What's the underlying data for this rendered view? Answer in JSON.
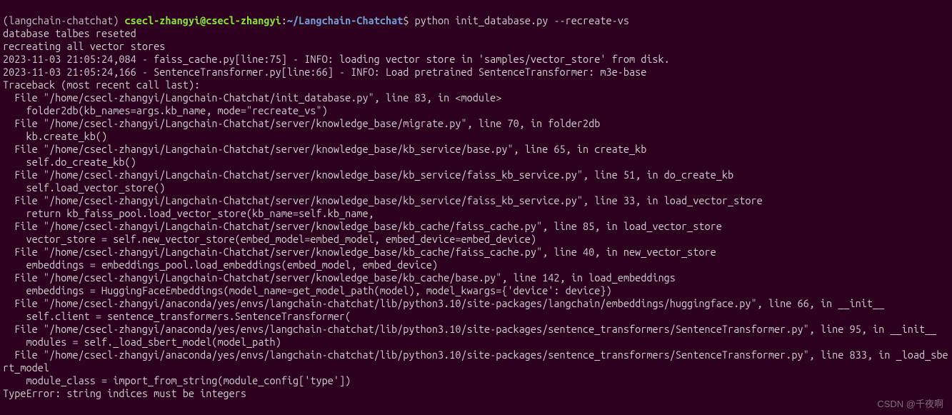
{
  "prompt": {
    "env": "(langchain-chatchat) ",
    "user_host": "csecl-zhangyi@csecl-zhangyi",
    "sep1": ":",
    "path": "~/Langchain-Chatchat",
    "sep2": "$ ",
    "command": "python init_database.py --recreate-vs"
  },
  "output": {
    "l01": "database talbes reseted",
    "l02": "recreating all vector stores",
    "l03": "2023-11-03 21:05:24,084 - faiss_cache.py[line:75] - INFO: loading vector store in 'samples/vector_store' from disk.",
    "l04": "2023-11-03 21:05:24,166 - SentenceTransformer.py[line:66] - INFO: Load pretrained SentenceTransformer: m3e-base",
    "l05": "Traceback (most recent call last):",
    "l06": "  File \"/home/csecl-zhangyi/Langchain-Chatchat/init_database.py\", line 83, in <module>",
    "l07": "    folder2db(kb_names=args.kb_name, mode=\"recreate_vs\")",
    "l08": "  File \"/home/csecl-zhangyi/Langchain-Chatchat/server/knowledge_base/migrate.py\", line 70, in folder2db",
    "l09": "    kb.create_kb()",
    "l10": "  File \"/home/csecl-zhangyi/Langchain-Chatchat/server/knowledge_base/kb_service/base.py\", line 65, in create_kb",
    "l11": "    self.do_create_kb()",
    "l12": "  File \"/home/csecl-zhangyi/Langchain-Chatchat/server/knowledge_base/kb_service/faiss_kb_service.py\", line 51, in do_create_kb",
    "l13": "    self.load_vector_store()",
    "l14": "  File \"/home/csecl-zhangyi/Langchain-Chatchat/server/knowledge_base/kb_service/faiss_kb_service.py\", line 33, in load_vector_store",
    "l15": "    return kb_faiss_pool.load_vector_store(kb_name=self.kb_name,",
    "l16": "  File \"/home/csecl-zhangyi/Langchain-Chatchat/server/knowledge_base/kb_cache/faiss_cache.py\", line 85, in load_vector_store",
    "l17": "    vector_store = self.new_vector_store(embed_model=embed_model, embed_device=embed_device)",
    "l18": "  File \"/home/csecl-zhangyi/Langchain-Chatchat/server/knowledge_base/kb_cache/faiss_cache.py\", line 40, in new_vector_store",
    "l19": "    embeddings = embeddings_pool.load_embeddings(embed_model, embed_device)",
    "l20": "  File \"/home/csecl-zhangyi/Langchain-Chatchat/server/knowledge_base/kb_cache/base.py\", line 142, in load_embeddings",
    "l21": "    embeddings = HuggingFaceEmbeddings(model_name=get_model_path(model), model_kwargs={'device': device})",
    "l22": "  File \"/home/csecl-zhangyi/anaconda/yes/envs/langchain-chatchat/lib/python3.10/site-packages/langchain/embeddings/huggingface.py\", line 66, in __init__",
    "l23": "    self.client = sentence_transformers.SentenceTransformer(",
    "l24": "  File \"/home/csecl-zhangyi/anaconda/yes/envs/langchain-chatchat/lib/python3.10/site-packages/sentence_transformers/SentenceTransformer.py\", line 95, in __init__",
    "l25": "    modules = self._load_sbert_model(model_path)",
    "l26": "  File \"/home/csecl-zhangyi/anaconda/yes/envs/langchain-chatchat/lib/python3.10/site-packages/sentence_transformers/SentenceTransformer.py\", line 833, in _load_sbert_model",
    "l27": "    module_class = import_from_string(module_config['type'])",
    "l28": "TypeError: string indices must be integers"
  },
  "watermark": "CSDN @千夜啊"
}
